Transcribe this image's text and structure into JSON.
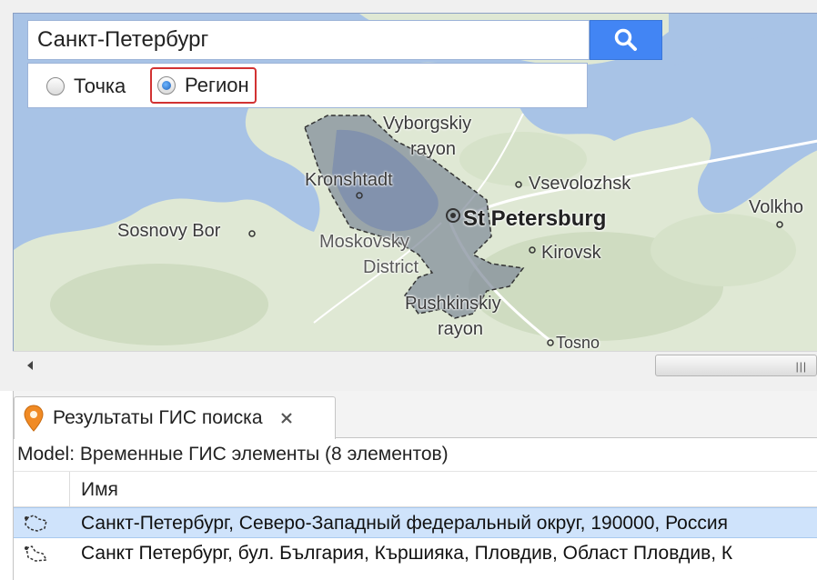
{
  "search": {
    "value": "Санкт-Петербург",
    "button_icon": "magnifier-icon"
  },
  "mode": {
    "options": [
      {
        "label": "Точка",
        "selected": false
      },
      {
        "label": "Регион",
        "selected": true
      }
    ],
    "highlight_color": "#d23232"
  },
  "map": {
    "labels": {
      "vyborgskiy_1": "Vyborgskiy",
      "vyborgskiy_2": "rayon",
      "kronshtadt": "Kronshtadt",
      "vsevolozhsk": "Vsevolozhsk",
      "st_petersburg": "St Petersburg",
      "sosnovy_bor": "Sosnovy Bor",
      "moskovsky_1": "Moskovsky",
      "moskovsky_2": "District",
      "kirovsk": "Kirovsk",
      "volkhov": "Volkho",
      "pushkinskiy_1": "Pushkinskiy",
      "pushkinskiy_2": "rayon",
      "tosno": "Tosno"
    },
    "colors": {
      "water": "#a8c3e6",
      "land": "#dfe8d4",
      "region": "#7f8a99"
    }
  },
  "results": {
    "tab_label": "Результаты ГИС поиска",
    "tab_icon": "map-pin-icon",
    "model_line": "Model: Временные ГИС элементы (8 элементов)",
    "column_name": "Имя",
    "rows": [
      {
        "text": "Санкт-Петербург, Северо-Западный федеральный округ, 190000, Россия",
        "selected": true
      },
      {
        "text": "Санкт Петербург, бул. България, Кършияка, Пловдив, Област Пловдив, К",
        "selected": false
      }
    ]
  }
}
